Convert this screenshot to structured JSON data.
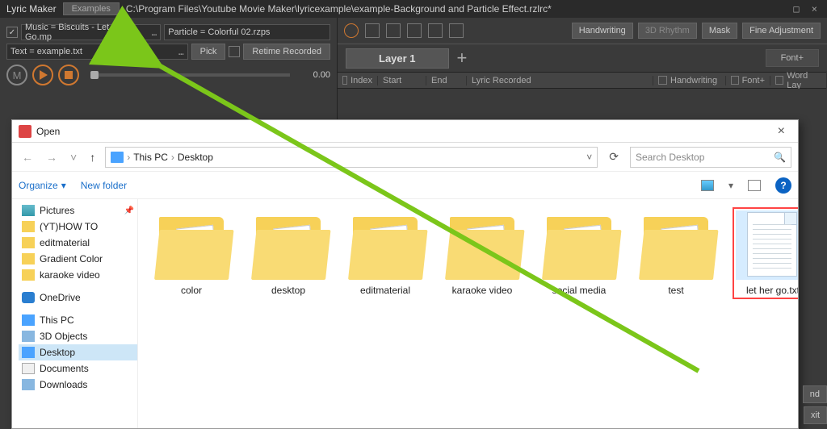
{
  "app": {
    "title": "Lyric Maker",
    "examples_btn": "Examples",
    "file_path": "C:\\Program Files\\Youtube Movie Maker\\lyricexample\\example-Background and Particle Effect.rzlrc*",
    "win_controls": "□ ×"
  },
  "left": {
    "music_field": "Music = Biscuits - Let Her Go.mp",
    "particle_field": "Particle = Colorful 02.rzps",
    "text_field": "Text = example.txt",
    "pick_btn": "Pick",
    "retime_btn": "Retime Recorded",
    "m_btn": "M",
    "time_readout": "0.00"
  },
  "right": {
    "buttons": {
      "handwriting": "Handwriting",
      "rhythm": "3D Rhythm",
      "mask": "Mask",
      "fine": "Fine Adjustment"
    },
    "layer_label": "Layer 1",
    "font_plus": "Font+",
    "headers": {
      "index": "Index",
      "start": "Start",
      "end": "End",
      "lyric": "Lyric Recorded",
      "hand": "Handwriting",
      "font": "Font+",
      "word": "Word Lay"
    }
  },
  "side_buttons": {
    "nd": "nd",
    "xit": "xit"
  },
  "dialog": {
    "title": "Open",
    "crumb": {
      "pc": "This PC",
      "loc": "Desktop"
    },
    "search_placeholder": "Search Desktop",
    "organize": "Organize",
    "new_folder": "New folder",
    "tree": [
      {
        "label": "Pictures",
        "icon": "pics",
        "pin": true
      },
      {
        "label": "(YT)HOW TO",
        "icon": "folder"
      },
      {
        "label": "editmaterial",
        "icon": "folder"
      },
      {
        "label": "Gradient Color",
        "icon": "folder"
      },
      {
        "label": "karaoke video",
        "icon": "folder"
      },
      {
        "sep": true
      },
      {
        "label": "OneDrive",
        "icon": "od"
      },
      {
        "sep": true
      },
      {
        "label": "This PC",
        "icon": "pc"
      },
      {
        "label": "3D Objects",
        "icon": "box"
      },
      {
        "label": "Desktop",
        "icon": "monitor",
        "selected": true
      },
      {
        "label": "Documents",
        "icon": "doc"
      },
      {
        "label": "Downloads",
        "icon": "dl"
      }
    ],
    "files": [
      {
        "name": "color",
        "type": "folder"
      },
      {
        "name": "desktop",
        "type": "folder"
      },
      {
        "name": "editmaterial",
        "type": "folder"
      },
      {
        "name": "karaoke video",
        "type": "folder"
      },
      {
        "name": "social media",
        "type": "folder"
      },
      {
        "name": "test",
        "type": "folder"
      },
      {
        "name": "let her go.txt",
        "type": "txt",
        "highlight": true
      }
    ]
  }
}
